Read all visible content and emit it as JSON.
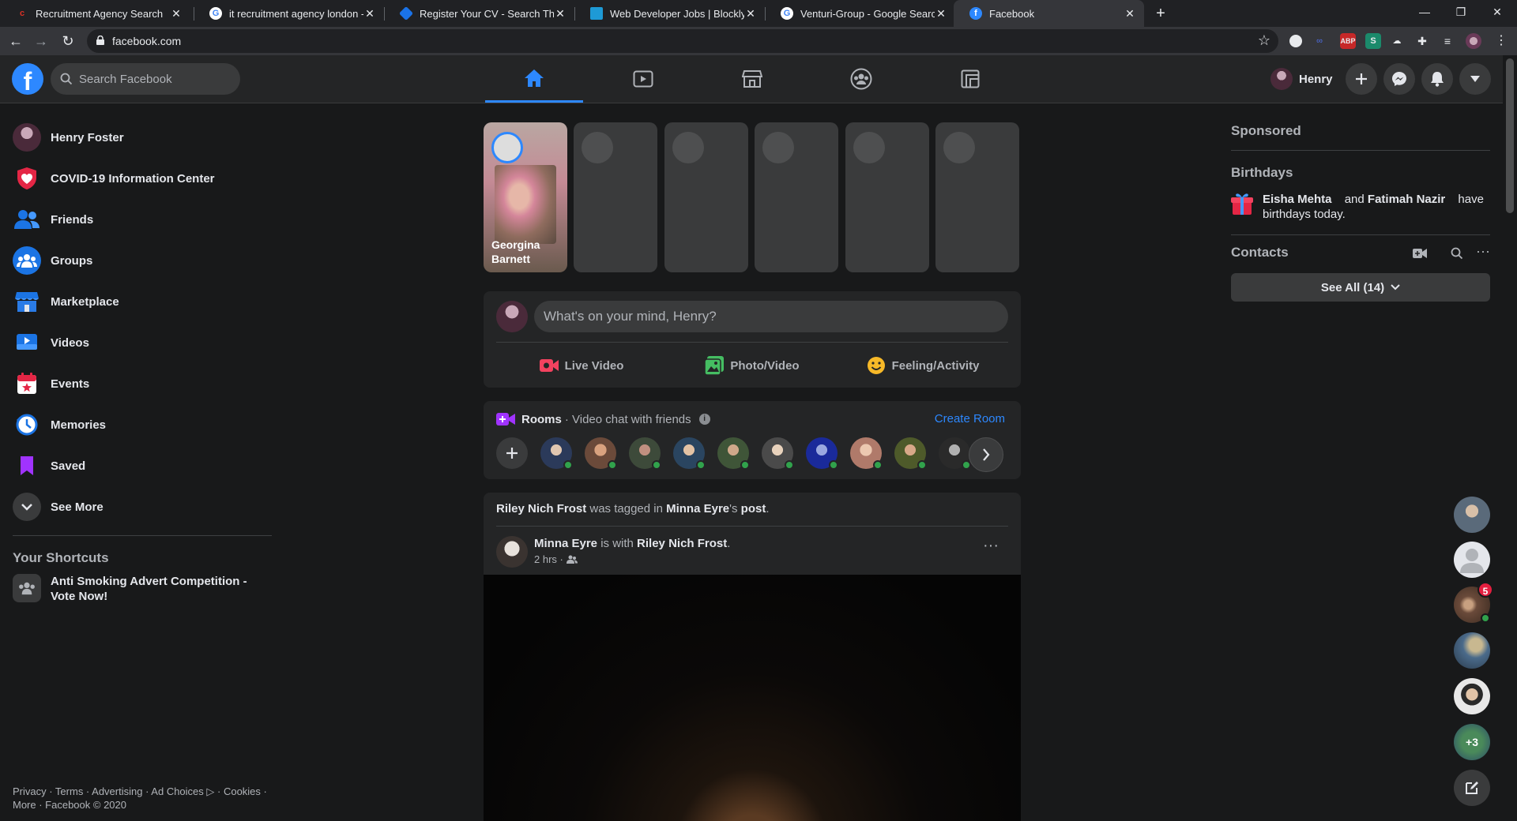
{
  "browser": {
    "tabs": [
      {
        "title": "Recruitment Agency Search",
        "favicon": "red-c-icon"
      },
      {
        "title": "it recruitment agency london - G",
        "favicon": "google-icon"
      },
      {
        "title": "Register Your CV - Search Thous",
        "favicon": "blue-diamond-icon"
      },
      {
        "title": "Web Developer Jobs | Blockly Lo",
        "favicon": "blue-square-icon"
      },
      {
        "title": "Venturi-Group - Google Search",
        "favicon": "google-icon"
      },
      {
        "title": "Facebook",
        "favicon": "facebook-icon"
      }
    ],
    "url": "facebook.com"
  },
  "header": {
    "search_placeholder": "Search Facebook",
    "profile_name": "Henry",
    "nav_tabs": [
      "home",
      "watch",
      "marketplace",
      "groups",
      "gaming"
    ]
  },
  "left_sidebar": {
    "profile": "Henry Foster",
    "items": [
      {
        "label": "COVID-19 Information Center",
        "icon": "covid-shield-icon"
      },
      {
        "label": "Friends",
        "icon": "friends-icon"
      },
      {
        "label": "Groups",
        "icon": "groups-icon"
      },
      {
        "label": "Marketplace",
        "icon": "marketplace-icon"
      },
      {
        "label": "Videos",
        "icon": "videos-icon"
      },
      {
        "label": "Events",
        "icon": "events-icon"
      },
      {
        "label": "Memories",
        "icon": "memories-icon"
      },
      {
        "label": "Saved",
        "icon": "saved-icon"
      },
      {
        "label": "See More",
        "icon": "chevron-down-icon"
      }
    ],
    "shortcuts_heading": "Your Shortcuts",
    "shortcuts": [
      "Anti Smoking Advert Competition - Vote Now!"
    ],
    "footer_line1": "Privacy · Terms · Advertising · Ad Choices ▷ · Cookies ·",
    "footer_line2": "More · Facebook © 2020"
  },
  "stories": {
    "first_name_line1": "Georgina",
    "first_name_line2": "Barnett"
  },
  "composer": {
    "prompt": "What's on your mind, Henry?",
    "actions": [
      "Live Video",
      "Photo/Video",
      "Feeling/Activity"
    ]
  },
  "rooms": {
    "title": "Rooms",
    "subtitle": "· Video chat with friends",
    "create": "Create Room"
  },
  "post": {
    "tag_user": "Riley Nich Frost",
    "tag_text1": " was tagged in ",
    "tag_owner": "Minna Eyre",
    "tag_text2": "'s ",
    "tag_post": "post",
    "tag_end": ".",
    "author": "Minna Eyre",
    "with_text": " is with ",
    "with_user": "Riley Nich Frost",
    "with_end": ".",
    "time": "2 hrs ·"
  },
  "right_sidebar": {
    "sponsored": "Sponsored",
    "birthdays_heading": "Birthdays",
    "bday_name1": "Eisha Mehta",
    "bday_and": " and ",
    "bday_name2": "Fatimah Nazir",
    "bday_tail": " have birthdays today.",
    "contacts_heading": "Contacts",
    "see_all": "See All (14)",
    "chat_badge": "5",
    "chat_more": "+3"
  },
  "colors": {
    "accent": "#2d88ff",
    "background": "#18191a",
    "card": "#242526",
    "online": "#31a24c",
    "badge": "#e41e3f"
  }
}
